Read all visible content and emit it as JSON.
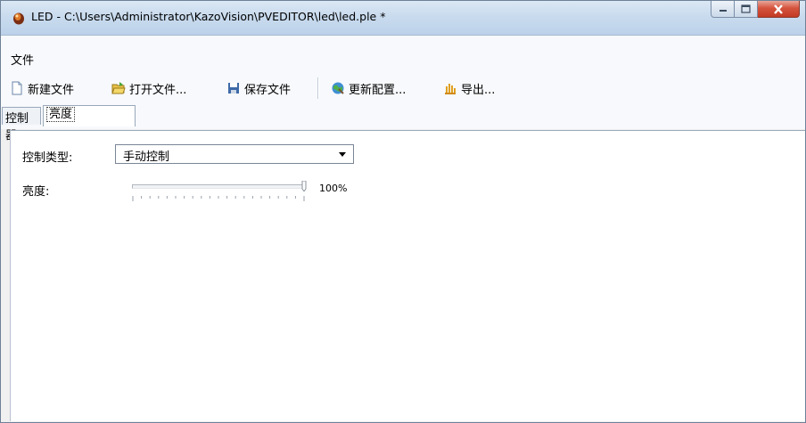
{
  "window": {
    "title": "LED - C:\\Users\\Administrator\\KazoVision\\PVEDITOR\\led\\led.ple *",
    "icon": "app-icon"
  },
  "menubar": {
    "items": [
      {
        "label": "文件"
      }
    ]
  },
  "toolbar": {
    "new": {
      "label": "新建文件",
      "icon": "new-file-icon"
    },
    "open": {
      "label": "打开文件...",
      "icon": "open-folder-icon"
    },
    "save": {
      "label": "保存文件",
      "icon": "save-icon"
    },
    "update": {
      "label": "更新配置...",
      "icon": "update-config-icon"
    },
    "export": {
      "label": "导出...",
      "icon": "export-icon"
    }
  },
  "tabs": [
    {
      "label": "控制器"
    },
    {
      "label": "亮度",
      "selected": true
    }
  ],
  "form": {
    "control_type_label": "控制类型:",
    "control_type_value": "手动控制",
    "brightness_label": "亮度:",
    "brightness_value": "100%",
    "brightness_level": 1.0
  },
  "colors": {
    "close_button": "#c8432b",
    "titlebar": "#c9dbee"
  }
}
